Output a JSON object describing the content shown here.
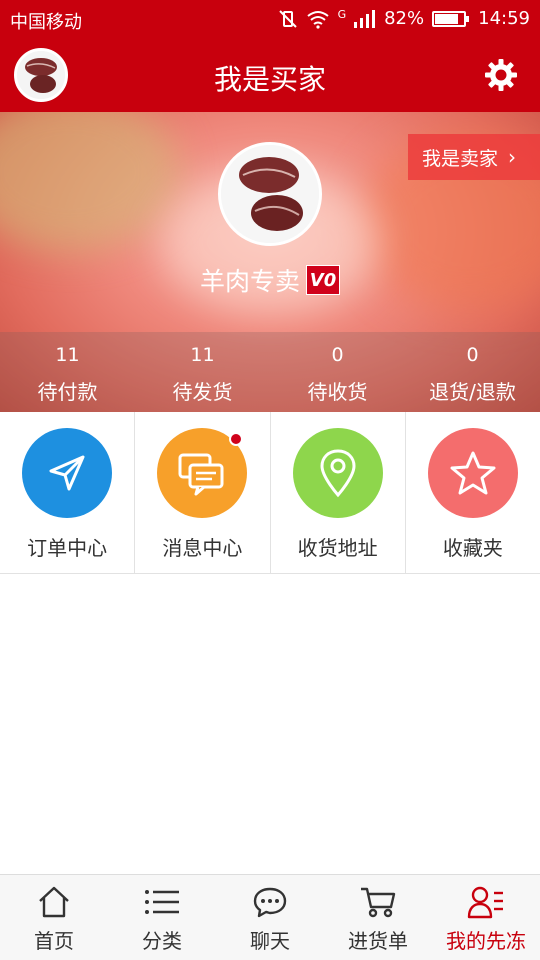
{
  "status_bar": {
    "carrier": "中国移动",
    "network": "G",
    "battery": "82%",
    "battery_level": 0.82,
    "time": "14:59"
  },
  "header": {
    "title": "我是买家"
  },
  "banner": {
    "seller_label": "我是卖家",
    "shop_name": "羊肉专卖",
    "vip_badge": "V0"
  },
  "stats": [
    {
      "count": "11",
      "label": "待付款"
    },
    {
      "count": "11",
      "label": "待发货"
    },
    {
      "count": "0",
      "label": "待收货"
    },
    {
      "count": "0",
      "label": "退货/退款"
    }
  ],
  "menu": [
    {
      "label": "订单中心",
      "icon": "paper-plane-icon",
      "color": "#1e90e0"
    },
    {
      "label": "消息中心",
      "icon": "chat-icon",
      "color": "#f7a02a"
    },
    {
      "label": "收货地址",
      "icon": "location-pin-icon",
      "color": "#8ed64c"
    },
    {
      "label": "收藏夹",
      "icon": "star-icon",
      "color": "#f46d6d"
    }
  ],
  "bottom_nav": [
    {
      "label": "首页",
      "icon": "home-icon"
    },
    {
      "label": "分类",
      "icon": "list-icon"
    },
    {
      "label": "聊天",
      "icon": "chat-bubble-icon"
    },
    {
      "label": "进货单",
      "icon": "cart-icon"
    },
    {
      "label": "我的先冻",
      "icon": "user-list-icon",
      "active": true
    }
  ],
  "colors": {
    "brand": "#c8000d",
    "active_nav": "#c8000d"
  }
}
